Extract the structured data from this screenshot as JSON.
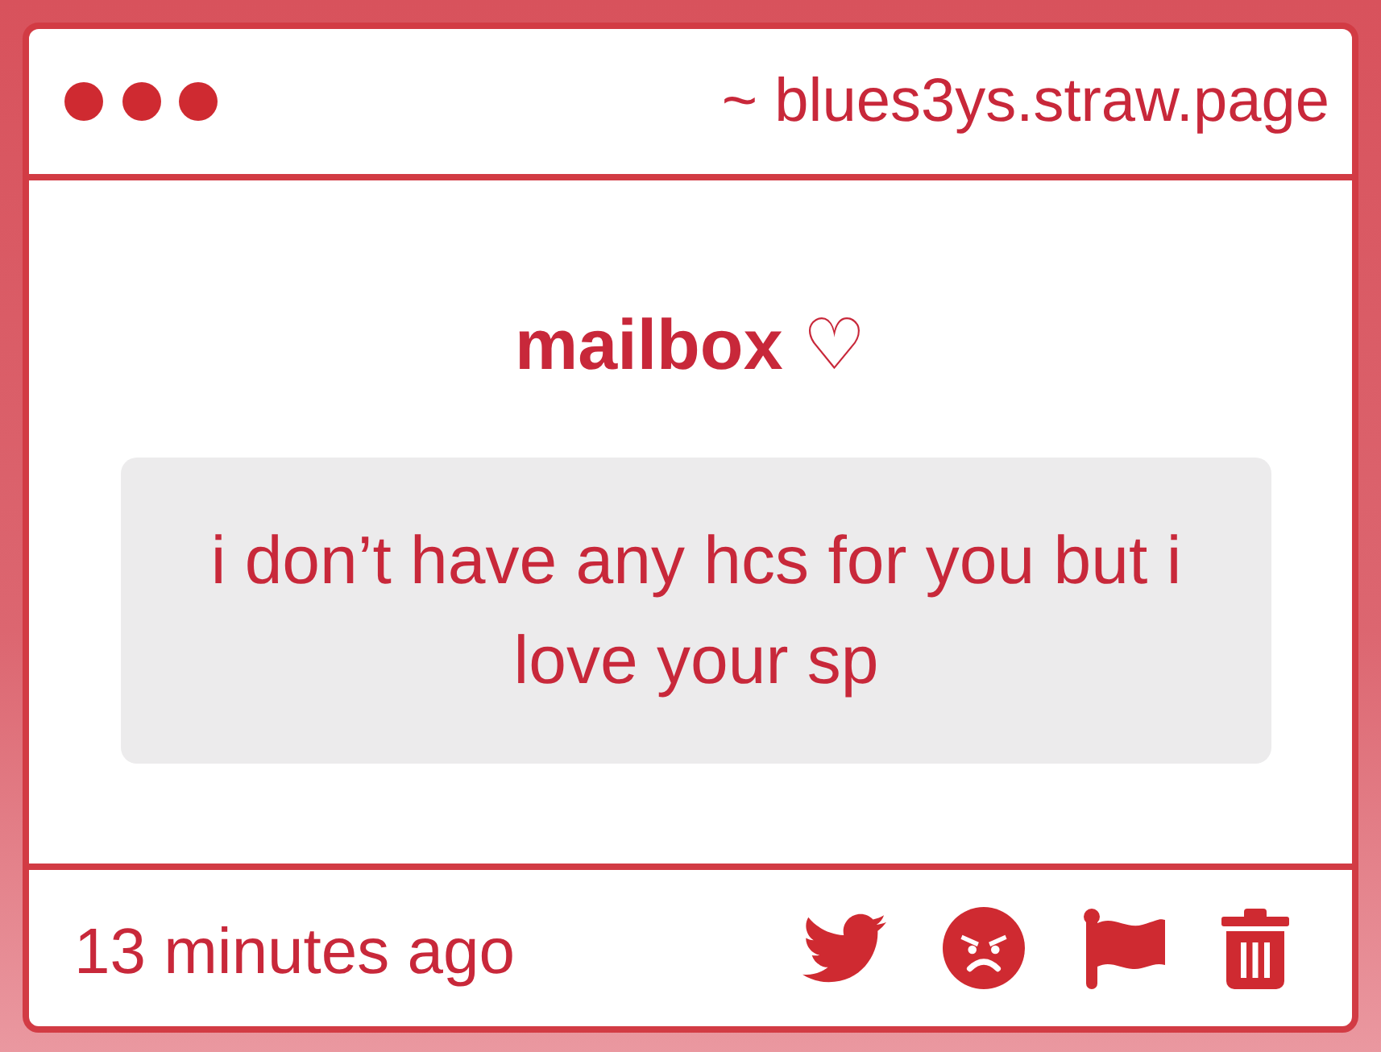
{
  "window": {
    "address": "~ blues3ys.straw.page"
  },
  "title": "**mailbox** ♡",
  "message": "i don’t have any hcs for you but i love your sp",
  "footer": {
    "time": "13 minutes ago"
  }
}
